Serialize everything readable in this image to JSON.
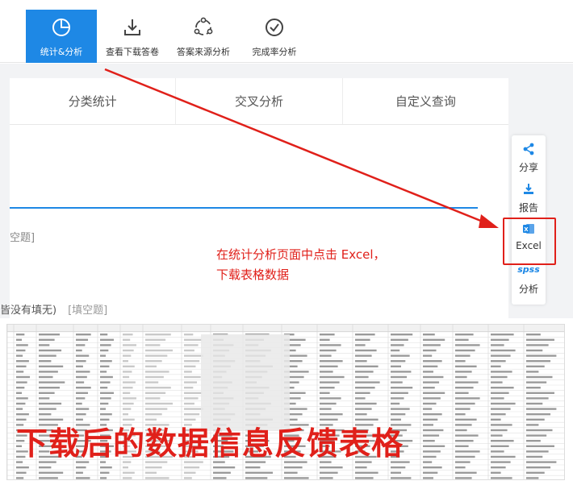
{
  "toolbar": {
    "items": [
      {
        "label": "统计&分析",
        "icon": "pie-chart-icon",
        "active": true
      },
      {
        "label": "查看下载答卷",
        "icon": "download-icon",
        "active": false
      },
      {
        "label": "答案来源分析",
        "icon": "share-nodes-icon",
        "active": false
      },
      {
        "label": "完成率分析",
        "icon": "check-circle-icon",
        "active": false
      }
    ]
  },
  "tabs": [
    {
      "label": "分类统计"
    },
    {
      "label": "交叉分析"
    },
    {
      "label": "自定义查询"
    }
  ],
  "panel": {
    "question_hint": "空题]"
  },
  "sidebar": {
    "items": [
      {
        "label": "分享",
        "icon": "share-icon"
      },
      {
        "label": "报告",
        "icon": "report-download-icon"
      },
      {
        "label": "Excel",
        "icon": "excel-icon"
      },
      {
        "label": "分析",
        "icon": "spss-icon",
        "badge": "spss"
      }
    ]
  },
  "annotation": {
    "line1": "在统计分析页面中点击 Excel，",
    "line2": "下载表格数据"
  },
  "hint_row": {
    "text": "皆没有填无)",
    "tag": "[填空题]"
  },
  "caption": "下载后的数据信息反馈表格",
  "colors": {
    "accent": "#1e88e5",
    "annotation_red": "#e0201a"
  }
}
